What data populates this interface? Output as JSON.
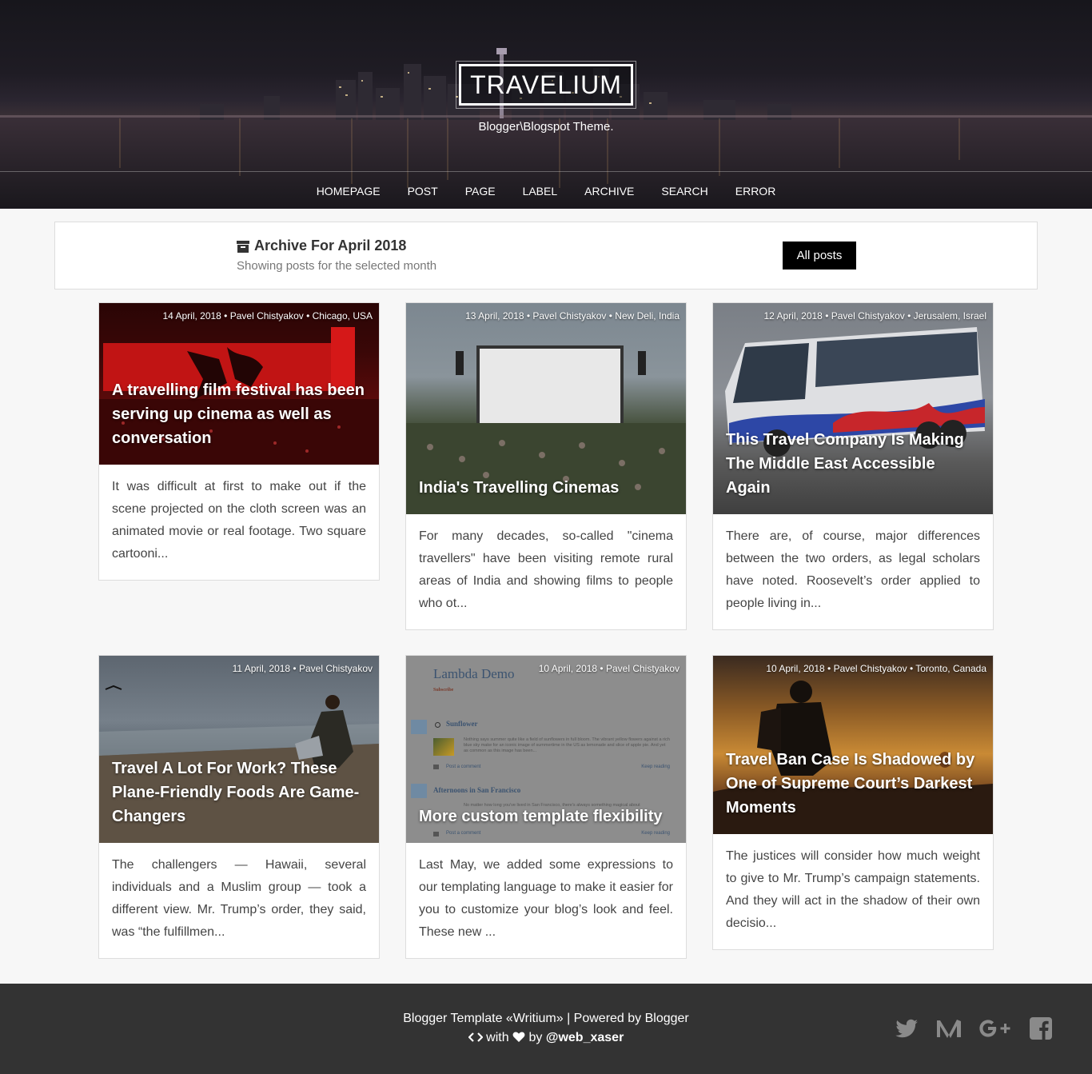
{
  "header": {
    "logo": "TRAVELIUM",
    "tagline": "Blogger\\Blogspot Theme.",
    "nav": [
      "HOMEPAGE",
      "POST",
      "PAGE",
      "LABEL",
      "ARCHIVE",
      "SEARCH",
      "ERROR"
    ]
  },
  "archive": {
    "title": "Archive For April 2018",
    "subtitle": "Showing posts for the selected month",
    "button": "All posts",
    "icon": "archive-box-icon"
  },
  "posts": [
    {
      "meta": "14 April, 2018 • Pavel Chistyakov • Chicago, USA",
      "title": "A travelling film festival has been serving up cinema as well as conversation",
      "excerpt": "It was difficult at first to make out if the scene projected on the cloth screen was an animated movie or real footage. Two square cartooni..."
    },
    {
      "meta": "13 April, 2018 • Pavel Chistyakov • New Deli, India",
      "title": "India's Travelling Cinemas",
      "excerpt": "For many decades, so-called \"cinema travellers\" have been visiting remote rural areas of India and showing films to people who ot..."
    },
    {
      "meta": "12 April, 2018 • Pavel Chistyakov • Jerusalem, Israel",
      "title": "This Travel Company Is Making The Middle East Accessible Again",
      "excerpt": "There are, of course, major differences between the two orders, as legal scholars have noted. Roosevelt’s order applied to people living in..."
    },
    {
      "meta": "11 April, 2018 • Pavel Chistyakov",
      "title": "Travel A Lot For Work? These Plane-Friendly Foods Are Game-Changers",
      "excerpt": "The challengers — Hawaii, several individuals and a Muslim group — took a different view. Mr. Trump’s order, they said, was “the fulfillmen..."
    },
    {
      "meta": "10 April, 2018 • Pavel Chistyakov",
      "title": "More custom template flexibility",
      "excerpt": "Last May, we added some expressions to our templating language to make it easier for you to customize your blog’s look and feel. These new ...",
      "screenshot": {
        "heading": "Lambda Demo",
        "subscribe": "Subscribe",
        "entry1": "Sunflower",
        "entry1_text": "Nothing says summer quite like a field of sunflowers in full bloom. The vibrant yellow flowers against a rich blue sky make for an iconic image of summertime in the US as lemonade and slice of apple pie. And yet as common as this image has been...",
        "post_comment": "Post a comment",
        "keep_reading": "Keep reading",
        "entry2": "Afternoons in San Francisco",
        "entry2_text": "No matter how long you've lived in San Francisco, there's always something magical about"
      }
    },
    {
      "meta": "10 April, 2018 • Pavel Chistyakov • Toronto, Canada",
      "title": "Travel Ban Case Is Shadowed by One of Supreme Court’s Darkest Moments",
      "excerpt": "The justices will consider how much weight to give to Mr. Trump’s campaign statements. And they will act in the shadow of their own decisio..."
    }
  ],
  "footer": {
    "line1": "Blogger Template «Writium» | Powered by Blogger",
    "with": "with",
    "by": "by",
    "author": "@web_xaser",
    "socials": [
      "twitter-icon",
      "medium-icon",
      "google-plus-icon",
      "facebook-icon"
    ]
  }
}
